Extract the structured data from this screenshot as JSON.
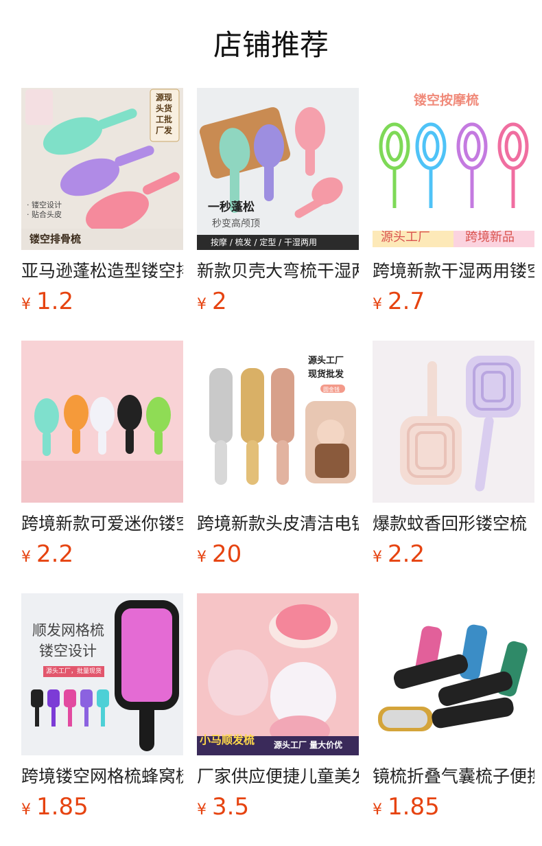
{
  "page": {
    "title": "店铺推荐"
  },
  "currency_symbol": "¥",
  "products": [
    {
      "name": "亚马逊蓬松造型镂空排骨梳",
      "price": "1.2",
      "image_text": {
        "badge": "源现\n头货\n工批\n厂发",
        "bullet1": "· 镂空设计",
        "bullet2": "· 贴合头皮",
        "caption": "镂空排骨梳"
      }
    },
    {
      "name": "新款贝壳大弯梳干湿两用",
      "price": "2",
      "image_text": {
        "headline": "一秒蓬松",
        "sub": "秒变高颅顶",
        "footer": "按摩 / 梳发 / 定型 / 干湿两用"
      }
    },
    {
      "name": "跨境新款干湿两用镂空按摩梳",
      "price": "2.7",
      "image_text": {
        "headline": "镂空按摩梳",
        "left_tag": "源头工厂",
        "right_tag": "跨境新品"
      }
    },
    {
      "name": "跨境新款可爱迷你镂空梳",
      "price": "2.2",
      "image_text": {}
    },
    {
      "name": "跨境新款头皮清洁电镀梳",
      "price": "20",
      "image_text": {
        "headline1": "源头工厂",
        "headline2": "现货批发",
        "chip": "圆金钱"
      }
    },
    {
      "name": "爆款蚊香回形镂空梳",
      "price": "2.2",
      "image_text": {}
    },
    {
      "name": "跨境镂空网格梳蜂窝梳",
      "price": "1.85",
      "image_text": {
        "headline1": "顺发网格梳",
        "headline2": "镂空设计",
        "chip": "源头工厂，批量现货"
      }
    },
    {
      "name": "厂家供应便捷儿童美发梳",
      "price": "3.5",
      "image_text": {
        "left_tag": "小马顺发梳",
        "right_tag": "源头工厂 量大价优"
      }
    },
    {
      "name": "镜梳折叠气囊梳子便携",
      "price": "1.85",
      "image_text": {}
    }
  ],
  "colors": {
    "price": "#e64310",
    "title": "#111111",
    "text": "#222222"
  }
}
